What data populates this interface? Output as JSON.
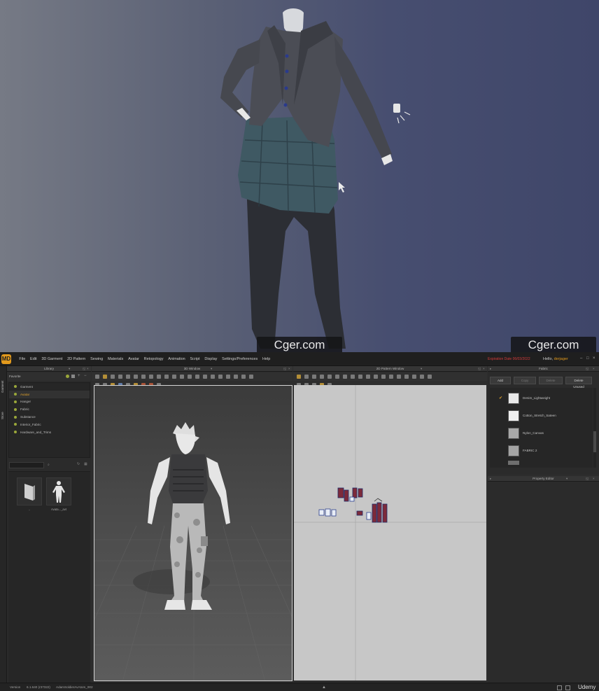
{
  "watermarks": [
    "Cger.com",
    "Cger.com"
  ],
  "app": {
    "logo": "MD",
    "menus": [
      "File",
      "Edit",
      "3D Garment",
      "2D Pattern",
      "Sewing",
      "Materials",
      "Avatar",
      "Retopology",
      "Animation",
      "Script",
      "Display",
      "Settings/Preferences",
      "Help"
    ],
    "expiration": "Expiration Date 06/03/2022",
    "hello_prefix": "Hello,",
    "user_name": "derjager",
    "accent": "#e39a1c"
  },
  "side_tabs": [
    "Garment",
    "Store"
  ],
  "library": {
    "title": "Library",
    "favorite": "Favorite",
    "items": [
      {
        "label": "Garment",
        "selected": false
      },
      {
        "label": "Avatar",
        "selected": true
      },
      {
        "label": "Hanger",
        "selected": false
      },
      {
        "label": "Fabric",
        "selected": false
      },
      {
        "label": "Substance",
        "selected": false
      },
      {
        "label": "Interior_Fabric",
        "selected": false
      },
      {
        "label": "Hardware_and_Trims",
        "selected": false
      }
    ],
    "files": [
      {
        "label": "..",
        "icon": "folder-up-icon"
      },
      {
        "label": "Avata..._avt",
        "icon": "avatar-icon"
      }
    ]
  },
  "window3d": {
    "title": "3D Window"
  },
  "window2d": {
    "title": "2D Pattern Window"
  },
  "fabric_panel": {
    "title": "Fabric",
    "buttons": {
      "add": "Add",
      "copy": "Copy",
      "delete": "Delete",
      "delete_unused": "Delete Unused"
    },
    "items": [
      {
        "name": "Denim_Lightweight",
        "swatch": "#e8e8e8",
        "checked": true
      },
      {
        "name": "Cotton_Stretch_Sateen",
        "swatch": "#efefef",
        "checked": false
      },
      {
        "name": "Nylon_Canvas",
        "swatch": "#a9a9a9",
        "checked": false
      },
      {
        "name": "FABRIC 2",
        "swatch": "#a4a4a4",
        "checked": false
      }
    ]
  },
  "property_editor": {
    "title": "Property Editor"
  },
  "status": {
    "version_label": "Version",
    "version": "6.1.640 (r37322)",
    "project": "AdamSoldierAvAtom_002",
    "brand": "Udemy"
  }
}
